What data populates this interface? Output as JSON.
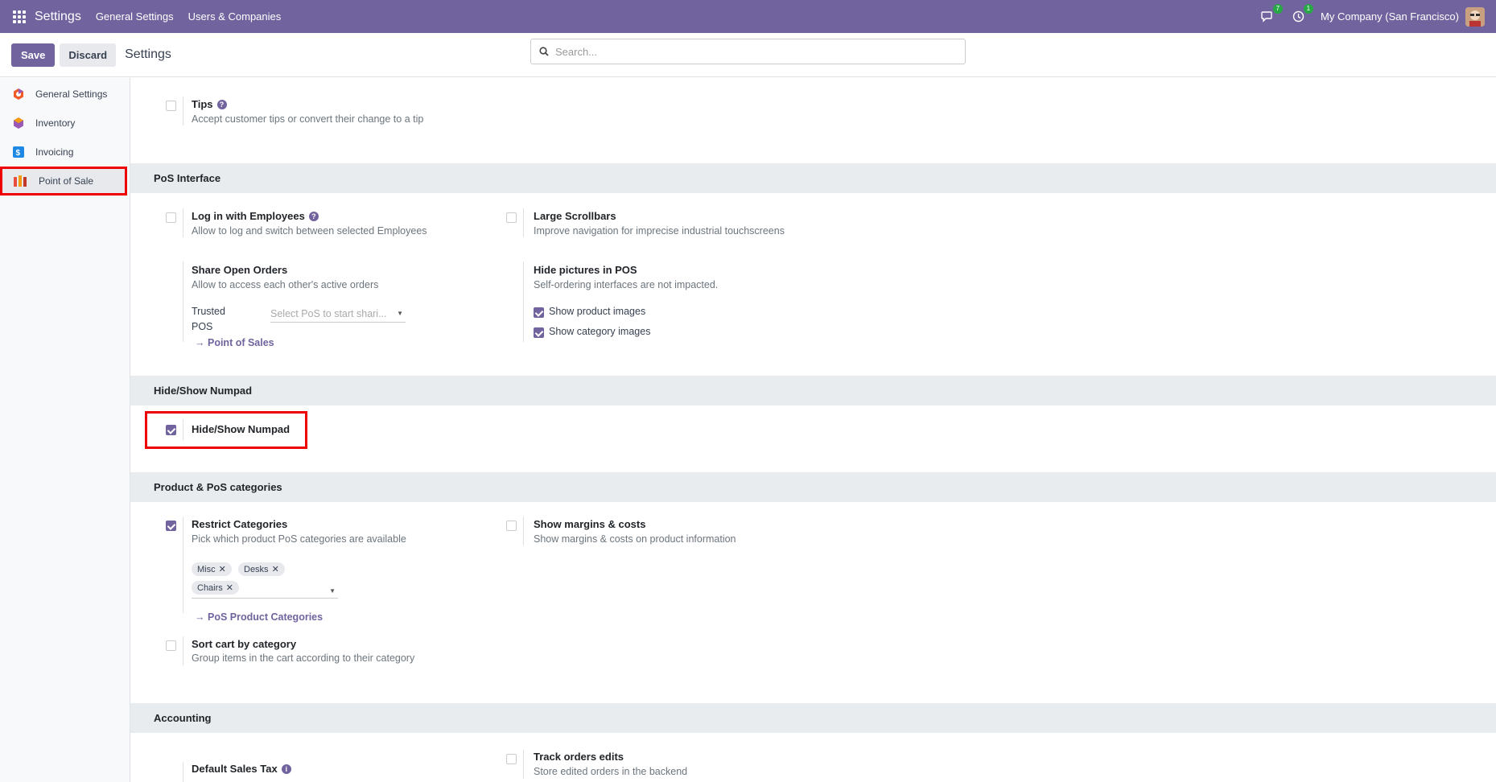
{
  "navbar": {
    "app_title": "Settings",
    "menu": [
      "General Settings",
      "Users & Companies"
    ],
    "messages_badge": "7",
    "activities_badge": "1",
    "company": "My Company (San Francisco)",
    "bg_color": "#71639e"
  },
  "control": {
    "save_label": "Save",
    "discard_label": "Discard",
    "breadcrumb": "Settings",
    "search_placeholder": "Search..."
  },
  "sidebar": {
    "items": [
      {
        "label": "General Settings",
        "icon": "general-settings-icon"
      },
      {
        "label": "Inventory",
        "icon": "inventory-icon"
      },
      {
        "label": "Invoicing",
        "icon": "invoicing-icon"
      },
      {
        "label": "Point of Sale",
        "icon": "point-of-sale-icon",
        "active": true
      }
    ]
  },
  "settings": {
    "tips": {
      "title": "Tips",
      "desc": "Accept customer tips or convert their change to a tip",
      "checked": false
    },
    "pos_interface": {
      "heading": "PoS Interface",
      "login_employees": {
        "title": "Log in with Employees",
        "desc": "Allow to log and switch between selected Employees",
        "checked": false
      },
      "large_scrollbars": {
        "title": "Large Scrollbars",
        "desc": "Improve navigation for imprecise industrial touchscreens",
        "checked": false
      },
      "share_orders": {
        "title": "Share Open Orders",
        "desc": "Allow to access each other's active orders",
        "trusted_label_1": "Trusted",
        "trusted_label_2": "POS",
        "trusted_placeholder": "Select PoS to start shari...",
        "link": "Point of Sales"
      },
      "hide_pictures": {
        "title": "Hide pictures in POS",
        "desc": "Self-ordering interfaces are not impacted.",
        "product_images": "Show product images",
        "category_images": "Show category images"
      }
    },
    "numpad": {
      "heading": "Hide/Show Numpad",
      "title": "Hide/Show Numpad",
      "checked": true
    },
    "categories": {
      "heading": "Product & PoS categories",
      "restrict": {
        "title": "Restrict Categories",
        "desc": "Pick which product PoS categories are available",
        "checked": true,
        "tags": [
          "Misc",
          "Desks",
          "Chairs"
        ],
        "link": "PoS Product Categories"
      },
      "margins": {
        "title": "Show margins & costs",
        "desc": "Show margins & costs on product information",
        "checked": false
      },
      "sort_cart": {
        "title": "Sort cart by category",
        "desc": "Group items in the cart according to their category",
        "checked": false
      }
    },
    "accounting": {
      "heading": "Accounting",
      "default_tax": {
        "title": "Default Sales Tax"
      },
      "track_edits": {
        "title": "Track orders edits",
        "desc": "Store edited orders in the backend",
        "checked": false
      }
    }
  }
}
